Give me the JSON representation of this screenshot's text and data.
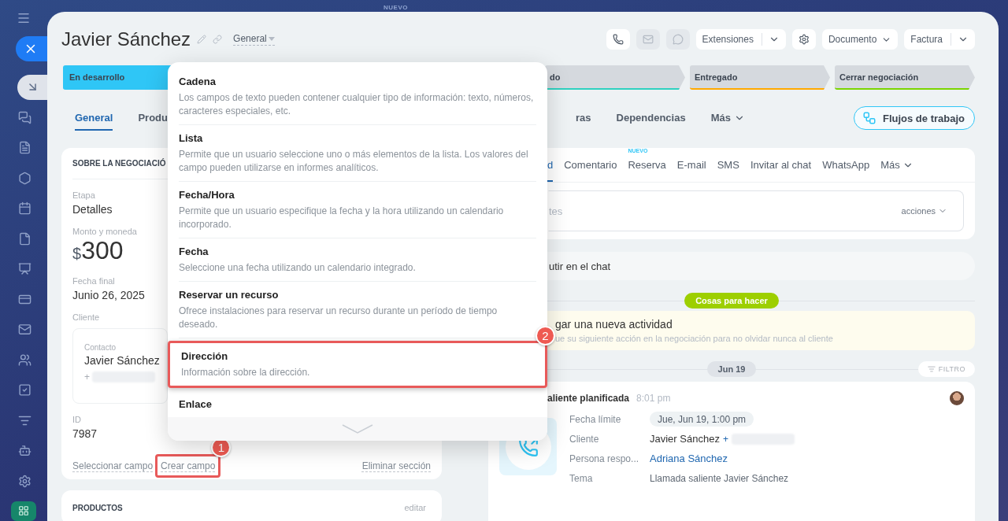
{
  "background_badge": "NUEVO",
  "sidebar": {
    "items": [
      {
        "kind": "inbox",
        "selected": true
      },
      {
        "kind": "chat",
        "selected": false
      },
      {
        "kind": "feed",
        "selected": false
      },
      {
        "kind": "hexagon",
        "selected": false
      },
      {
        "kind": "calendar",
        "selected": false
      },
      {
        "kind": "document",
        "selected": false
      },
      {
        "kind": "board",
        "selected": false
      },
      {
        "kind": "card",
        "selected": false
      },
      {
        "kind": "mail",
        "selected": false
      },
      {
        "kind": "users",
        "selected": false
      },
      {
        "kind": "tasks",
        "selected": false
      },
      {
        "kind": "funnel",
        "selected": false
      },
      {
        "kind": "robot",
        "selected": false
      },
      {
        "kind": "settings",
        "selected": false
      },
      {
        "kind": "app",
        "selected": false
      }
    ]
  },
  "header": {
    "title": "Javier Sánchez",
    "view": "General",
    "buttons": [
      {
        "kind": "phone",
        "disabled": false
      },
      {
        "kind": "mail",
        "disabled": true
      },
      {
        "kind": "chat",
        "disabled": true
      },
      {
        "kind": "split",
        "label": "Extensiones"
      },
      {
        "kind": "settings",
        "disabled": false
      },
      {
        "kind": "menu",
        "label": "Documento"
      },
      {
        "kind": "split",
        "label": "Factura"
      }
    ]
  },
  "stages": [
    {
      "label": "En desarrollo",
      "color": "#2fc6f6",
      "selected": true
    },
    {
      "label": "do",
      "color": "#2fd1c0",
      "selected": false
    },
    {
      "label": "Entregado",
      "color": "#ffa900",
      "selected": false
    },
    {
      "label": "Cerrar negociación",
      "color": "#7bd500",
      "selected": false
    }
  ],
  "tabs": [
    {
      "label": "General",
      "selected": true,
      "kind": "tab"
    },
    {
      "label": "Produ",
      "selected": false,
      "kind": "tab"
    },
    {
      "label": "ras",
      "selected": false,
      "kind": "tab"
    },
    {
      "label": "Dependencias",
      "selected": false,
      "kind": "tab"
    },
    {
      "label": "Más",
      "selected": false,
      "kind": "more"
    }
  ],
  "workflows_button": "Flujos de trabajo",
  "about_card": {
    "title": "SOBRE LA NEGOCIACIÓ",
    "fields": [
      {
        "kind": "text",
        "label": "Etapa",
        "value": "Detalles"
      },
      {
        "kind": "money",
        "label": "Monto y moneda",
        "currency": "$",
        "value": "300"
      },
      {
        "kind": "text",
        "label": "Fecha final",
        "value": "Junio 26, 2025"
      },
      {
        "kind": "contact",
        "label": "Cliente",
        "contact_label": "Contacto",
        "name": "Javier Sánchez",
        "phone_prefix": "+"
      },
      {
        "kind": "text",
        "label": "ID",
        "value": "7987"
      }
    ],
    "links": [
      {
        "label": "Seleccionar campo",
        "highlighted": false
      },
      {
        "label": "Crear campo",
        "highlighted": true,
        "marker": "1"
      }
    ],
    "delete_link": "Eliminar sección"
  },
  "products_card": {
    "title": "PRODUCTOS",
    "action": "editar"
  },
  "field_menu": {
    "items": [
      {
        "title": "Cadena",
        "description": "Los campos de texto pueden contener cualquier tipo de información: texto, números, caracteres especiales, etc.",
        "highlighted": false
      },
      {
        "title": "Lista",
        "description": "Permite que un usuario seleccione uno o más elementos de la lista. Los valores del campo pueden utilizarse en informes analíticos.",
        "highlighted": false
      },
      {
        "title": "Fecha/Hora",
        "description": "Permite que un usuario especifique la fecha y la hora utilizando un calendario incorporado.",
        "highlighted": false
      },
      {
        "title": "Fecha",
        "description": "Seleccione una fecha utilizando un calendario integrado.",
        "highlighted": false
      },
      {
        "title": "Reservar un recurso",
        "description": "Ofrece instalaciones para reservar un recurso durante un período de tiempo deseado.",
        "highlighted": false
      },
      {
        "title": "Dirección",
        "description": "Información sobre la dirección.",
        "highlighted": true,
        "marker": "2"
      },
      {
        "title": "Enlace",
        "highlighted": false
      }
    ]
  },
  "timeline_tabs": [
    {
      "label": "d",
      "selected": true,
      "kind": "tab"
    },
    {
      "label": "Comentario",
      "selected": false,
      "kind": "tab"
    },
    {
      "label": "Reserva",
      "selected": false,
      "kind": "tab",
      "badge": "NUEVO"
    },
    {
      "label": "E-mail",
      "selected": false,
      "kind": "tab"
    },
    {
      "label": "SMS",
      "selected": false,
      "kind": "tab"
    },
    {
      "label": "Invitar al chat",
      "selected": false,
      "kind": "tab"
    },
    {
      "label": "WhatsApp",
      "selected": false,
      "kind": "tab"
    },
    {
      "label": "Más",
      "selected": false,
      "kind": "more"
    }
  ],
  "composer": {
    "placeholder": "tes",
    "actions": "acciones"
  },
  "chat_bar": "utir en el chat",
  "todo_label": "Cosas para hacer",
  "new_activity": {
    "title": "gar una nueva actividad",
    "hint": "ue su siguiente acción en la negociación para no olvidar nunca al cliente"
  },
  "date_label": "Jun 19",
  "filter_button": "FILTRO",
  "activity": {
    "title": "aliente planificada",
    "time": "8:01 pm",
    "fields": [
      {
        "kind": "pill",
        "label": "Fecha límite",
        "value": "Jue, Jun 19, 1:00 pm"
      },
      {
        "kind": "contact",
        "label": "Cliente",
        "value": "Javier Sánchez",
        "phone_prefix": "+"
      },
      {
        "kind": "link",
        "label": "Persona respo...",
        "value": "Adriana Sánchez"
      },
      {
        "kind": "muted",
        "label": "Tema",
        "value": "Llamada saliente Javier Sánchez"
      }
    ]
  }
}
